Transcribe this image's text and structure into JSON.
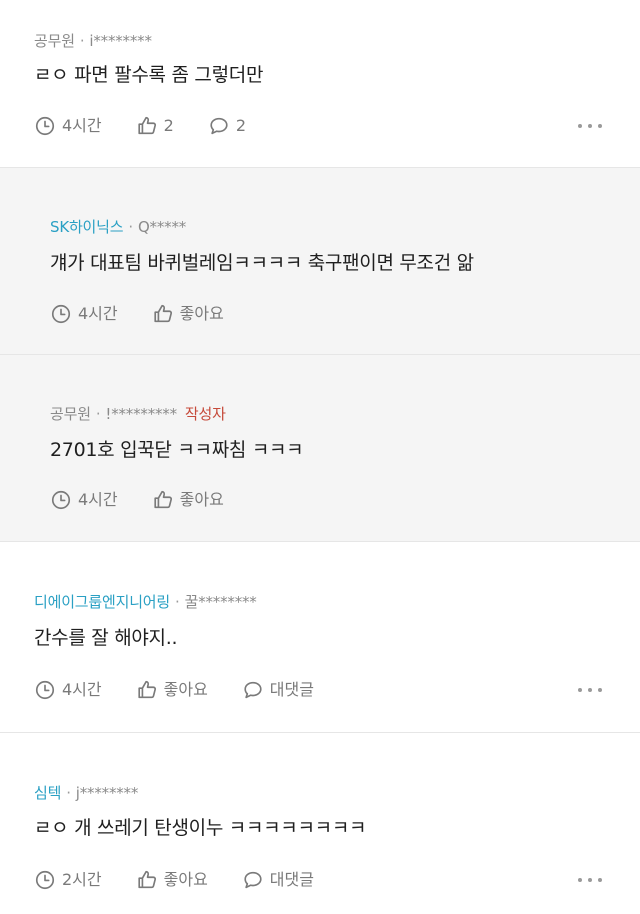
{
  "comments": [
    {
      "company": "공무원",
      "user": "i********",
      "text": "ㄹㅇ 파면 팔수록 좀 그렇더만",
      "time": "4시간",
      "likes": "2",
      "replies": "2"
    },
    {
      "company": "SK하이닉스",
      "user": "Q*****",
      "text": "걔가 대표팀 바퀴벌레임ㅋㅋㅋㅋ 축구팬이면 무조건 앎",
      "time": "4시간",
      "like_label": "좋아요"
    },
    {
      "company": "공무원",
      "user": "!*********",
      "badge": "작성자",
      "text": "2701호 입꾹닫 ㅋㅋ짜침 ㅋㅋㅋ",
      "time": "4시간",
      "like_label": "좋아요"
    },
    {
      "company": "디에이그룹엔지니어링",
      "user": "꿀********",
      "text": "간수를 잘 해야지..",
      "time": "4시간",
      "like_label": "좋아요",
      "reply_label": "대댓글"
    },
    {
      "company": "심텍",
      "user": "j********",
      "text": "ㄹㅇ 개 쓰레기 탄생이누 ㅋㅋㅋㅋㅋㅋㅋㅋ",
      "time": "2시간",
      "like_label": "좋아요",
      "reply_label": "대댓글"
    }
  ],
  "meta_separator": "·",
  "icons": {
    "time": "clock-icon",
    "like": "thumbs-up-icon",
    "reply": "speech-bubble-icon",
    "more": "more-dots-icon"
  },
  "colors": {
    "company_link": "#2aa0c4",
    "author_badge": "#c64a3a",
    "reply_background": "#f5f5f5"
  }
}
